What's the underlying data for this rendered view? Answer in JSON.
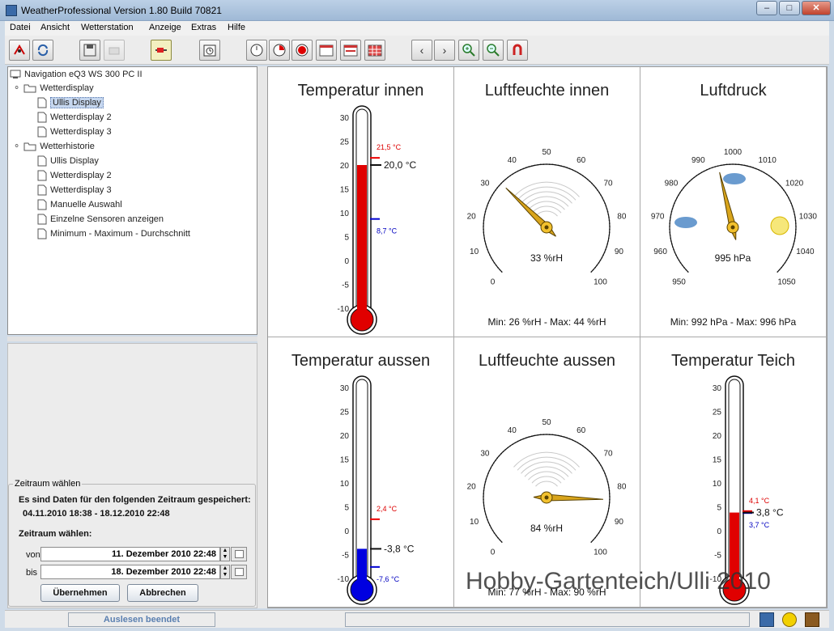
{
  "window": {
    "title": "WeatherProfessional   Version 1.80  Build 70821"
  },
  "menu": [
    "Datei",
    "Ansicht",
    "Wetterstation",
    "Anzeige",
    "Extras",
    "Hilfe"
  ],
  "navigation": {
    "root": "Navigation eQ3 WS 300 PC II",
    "groups": [
      {
        "label": "Wetterdisplay",
        "items": [
          "Ullis Display",
          "Wetterdisplay 2",
          "Wetterdisplay 3"
        ]
      },
      {
        "label": "Wetterhistorie",
        "items": [
          "Ullis Display",
          "Wetterdisplay 2",
          "Wetterdisplay 3",
          "Manuelle Auswahl",
          "Einzelne Sensoren anzeigen",
          "Minimum - Maximum - Durchschnitt"
        ]
      }
    ],
    "selected": "Ullis Display"
  },
  "zeitraum": {
    "legend": "Zeitraum wählen",
    "info": "Es sind Daten für den folgenden Zeitraum gespeichert:",
    "range": "04.11.2010 18:38 - 18.12.2010 22:48",
    "choose_label": "Zeitraum wählen:",
    "von_label": "von",
    "von_value": "11. Dezember 2010 22:48",
    "bis_label": "bis",
    "bis_value": "18. Dezember 2010 22:48",
    "apply": "Übernehmen",
    "cancel": "Abbrechen"
  },
  "panels": {
    "temp_innen": {
      "title": "Temperatur innen",
      "value": 20.0,
      "value_label": "20,0 °C",
      "max": 21.5,
      "max_label": "21,5 °C",
      "min": 8.7,
      "min_label": "8,7 °C",
      "ticks": [
        "30",
        "25",
        "20",
        "15",
        "10",
        "5",
        "0",
        "-5",
        "-10"
      ],
      "color": "#e00000"
    },
    "luft_innen": {
      "title": "Luftfeuchte innen",
      "value": 33,
      "value_label": "33 %rH",
      "ticks": [
        "0",
        "10",
        "20",
        "30",
        "40",
        "50",
        "60",
        "70",
        "80",
        "90",
        "100"
      ],
      "minmax": "Min: 26 %rH - Max: 44 %rH"
    },
    "luftdruck": {
      "title": "Luftdruck",
      "value": 995,
      "value_label": "995 hPa",
      "ticks": [
        "950",
        "960",
        "970",
        "980",
        "990",
        "1000",
        "1010",
        "1020",
        "1030",
        "1040",
        "1050"
      ],
      "minmax": "Min: 992 hPa - Max: 996 hPa"
    },
    "temp_aussen": {
      "title": "Temperatur aussen",
      "value": -3.8,
      "value_label": "-3,8 °C",
      "max": 2.4,
      "max_label": "2,4 °C",
      "min": -7.6,
      "min_label": "-7,6 °C",
      "ticks": [
        "30",
        "25",
        "20",
        "15",
        "10",
        "5",
        "0",
        "-5",
        "-10"
      ],
      "color": "#0000e0"
    },
    "luft_aussen": {
      "title": "Luftfeuchte aussen",
      "value": 84,
      "value_label": "84 %rH",
      "ticks": [
        "0",
        "10",
        "20",
        "30",
        "40",
        "50",
        "60",
        "70",
        "80",
        "90",
        "100"
      ],
      "minmax": "Min: 77 %rH - Max: 90 %rH"
    },
    "temp_teich": {
      "title": "Temperatur Teich",
      "value": 3.8,
      "value_label": "3,8 °C",
      "max": 4.1,
      "max_label": "4,1 °C",
      "min": 3.7,
      "min_label": "3,7 °C",
      "ticks": [
        "30",
        "25",
        "20",
        "15",
        "10",
        "5",
        "0",
        "-5",
        "-10"
      ],
      "color": "#e00000"
    }
  },
  "status": {
    "text": "Auslesen beendet"
  },
  "watermark": "Hobby-Gartenteich/Ulli 2010"
}
